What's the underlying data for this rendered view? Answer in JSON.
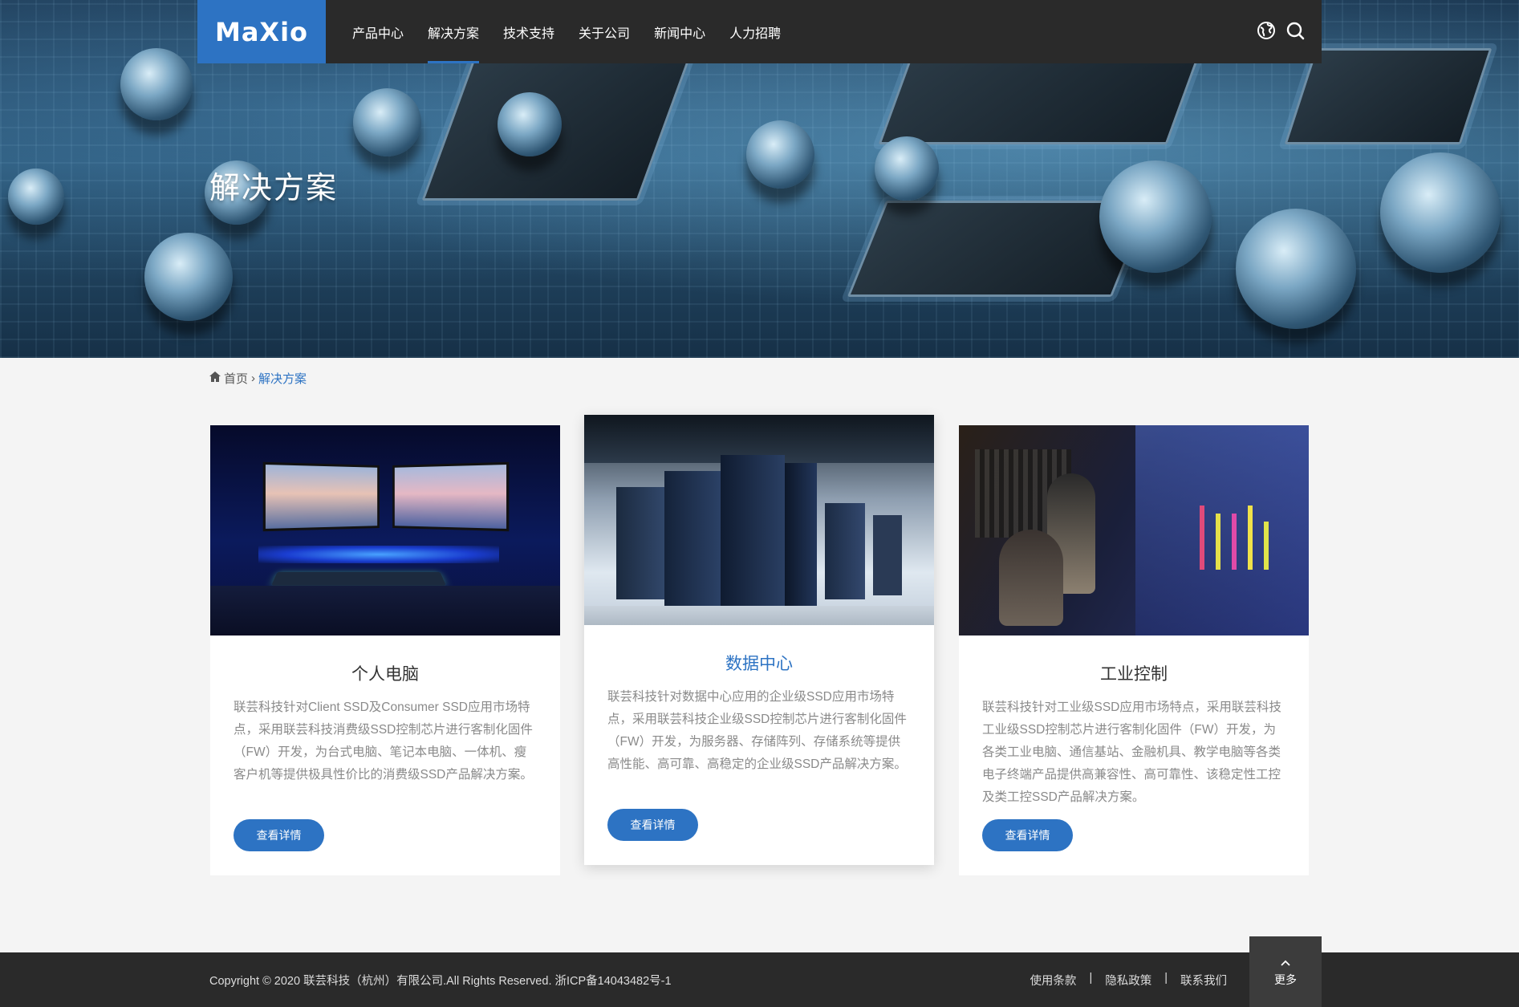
{
  "brand": {
    "logo_text": "MaXio",
    "accent": "#2d73c3"
  },
  "nav": {
    "items": [
      {
        "label": "产品中心"
      },
      {
        "label": "解决方案"
      },
      {
        "label": "技术支持"
      },
      {
        "label": "关于公司"
      },
      {
        "label": "新闻中心"
      },
      {
        "label": "人力招聘"
      }
    ],
    "active_index": 1,
    "icons": [
      "globe-icon",
      "search-icon"
    ]
  },
  "hero": {
    "title": "解决方案"
  },
  "breadcrumb": {
    "home": "首页",
    "separator": "›",
    "current": "解决方案"
  },
  "cards": [
    {
      "title": "个人电脑",
      "description": "联芸科技针对Client SSD及Consumer SSD应用市场特点，采用联芸科技消费级SSD控制芯片进行客制化固件（FW）开发，为台式电脑、笔记本电脑、一体机、瘦客户机等提供极具性价比的消费级SSD产品解决方案。",
      "button": "查看详情"
    },
    {
      "title": "数据中心",
      "description": "联芸科技针对数据中心应用的企业级SSD应用市场特点，采用联芸科技企业级SSD控制芯片进行客制化固件（FW）开发，为服务器、存储阵列、存储系统等提供高性能、高可靠、高稳定的企业级SSD产品解决方案。",
      "button": "查看详情"
    },
    {
      "title": "工业控制",
      "description": "联芸科技针对工业级SSD应用市场特点，采用联芸科技工业级SSD控制芯片进行客制化固件（FW）开发，为各类工业电脑、通信基站、金融机具、教学电脑等各类电子终端产品提供高兼容性、高可靠性、该稳定性工控及类工控SSD产品解决方案。",
      "button": "查看详情"
    }
  ],
  "footer": {
    "copyright": "Copyright © 2020 联芸科技（杭州）有限公司.All Rights Reserved. 浙ICP备14043482号-1",
    "links": [
      "使用条款",
      "隐私政策",
      "联系我们"
    ],
    "separator": "|",
    "more": "更多"
  }
}
